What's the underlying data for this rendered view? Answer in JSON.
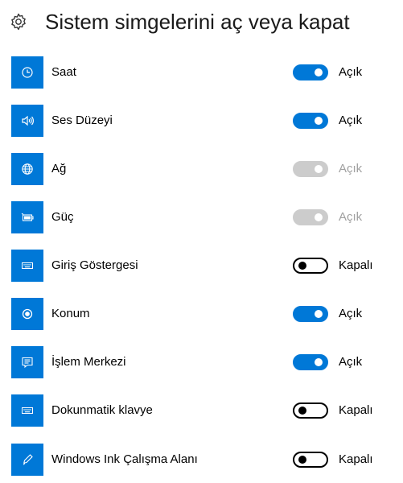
{
  "header": {
    "title": "Sistem simgelerini aç veya kapat",
    "icon": "gear-icon"
  },
  "colors": {
    "accent": "#0078d7",
    "disabled": "#cccccc",
    "disabled_text": "#a0a0a0"
  },
  "items": [
    {
      "label": "Saat",
      "icon": "clock-icon",
      "state": "on",
      "state_label": "Açık"
    },
    {
      "label": "Ses Düzeyi",
      "icon": "volume-icon",
      "state": "on",
      "state_label": "Açık"
    },
    {
      "label": "Ağ",
      "icon": "network-globe-icon",
      "state": "disabled",
      "state_label": "Açık"
    },
    {
      "label": "Güç",
      "icon": "battery-icon",
      "state": "disabled",
      "state_label": "Açık"
    },
    {
      "label": "Giriş Göstergesi",
      "icon": "keyboard-icon",
      "state": "off",
      "state_label": "Kapalı"
    },
    {
      "label": "Konum",
      "icon": "location-icon",
      "state": "on",
      "state_label": "Açık"
    },
    {
      "label": "İşlem Merkezi",
      "icon": "action-center-icon",
      "state": "on",
      "state_label": "Açık"
    },
    {
      "label": "Dokunmatik klavye",
      "icon": "touch-keyboard-icon",
      "state": "off",
      "state_label": "Kapalı"
    },
    {
      "label": "Windows Ink Çalışma Alanı",
      "icon": "pen-icon",
      "state": "off",
      "state_label": "Kapalı"
    }
  ]
}
